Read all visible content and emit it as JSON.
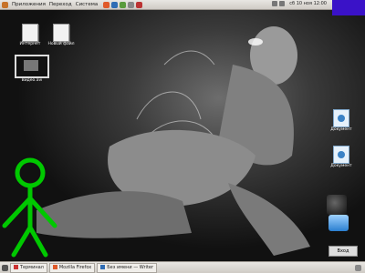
{
  "top_panel": {
    "menus": [
      "Приложения",
      "Переход",
      "Система"
    ],
    "clock": "сб 10 ноя 12:00"
  },
  "desktop": {
    "icons": [
      {
        "label": "Интернет"
      },
      {
        "label": "Новый файл"
      },
      {
        "label": "Видео.avi"
      },
      {
        "label": "Документ"
      },
      {
        "label": "Документ"
      }
    ]
  },
  "side_applet": {
    "button_label": "Вход"
  },
  "taskbar": {
    "tasks": [
      {
        "label": "Терминал"
      },
      {
        "label": "Mozilla Firefox"
      },
      {
        "label": "Без имени — Writer"
      }
    ]
  },
  "colors": {
    "stickman": "#00c800",
    "accent_block": "#3a12c8"
  }
}
